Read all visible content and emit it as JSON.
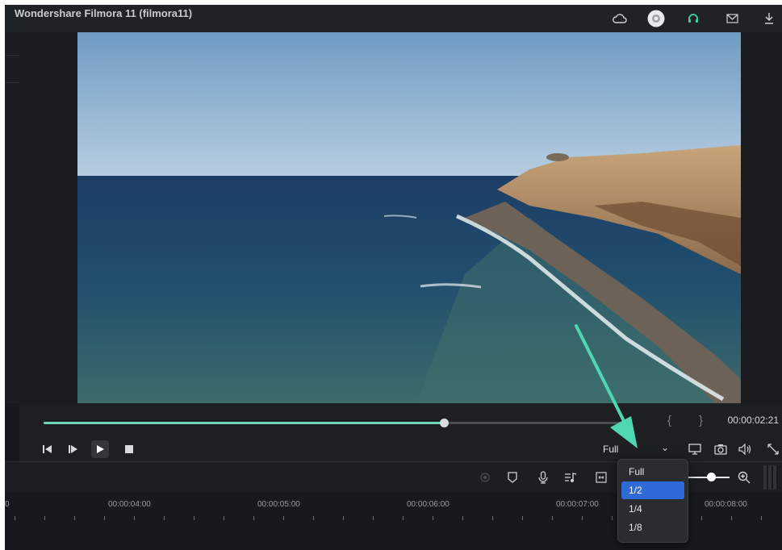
{
  "window": {
    "title": "Wondershare Filmora 11 (filmora11)"
  },
  "titlebar_icons": [
    "cloud-icon",
    "user-avatar-icon",
    "headset-icon",
    "mail-icon",
    "download-icon"
  ],
  "player": {
    "progress": 0.68,
    "timecode": "00:00:02:21",
    "mark_in": "{",
    "mark_out": "}",
    "quality": "Full",
    "buttons": [
      "prev-frame-icon",
      "next-frame-icon",
      "play-icon",
      "stop-icon"
    ],
    "right_icons": [
      "display-icon",
      "snapshot-icon",
      "volume-icon",
      "fullscreen-icon"
    ]
  },
  "quality_menu": {
    "options": [
      "Full",
      "1/2",
      "1/4",
      "1/8"
    ],
    "selected": "1/2"
  },
  "toolbar_icons": [
    "render-icon",
    "marker-icon",
    "microphone-icon",
    "audio-mixer-icon",
    "fit-icon",
    "zoom-in-icon"
  ],
  "timeline": {
    "labels": [
      "00:00:04:00",
      "00:00:05:00",
      "00:00:06:00",
      "00:00:07:00",
      "00:00:08:00"
    ],
    "edge_label": "0"
  },
  "colors": {
    "accent": "#6fd5b8",
    "selection": "#2f6bd6",
    "arrow": "#4fd6b2"
  }
}
